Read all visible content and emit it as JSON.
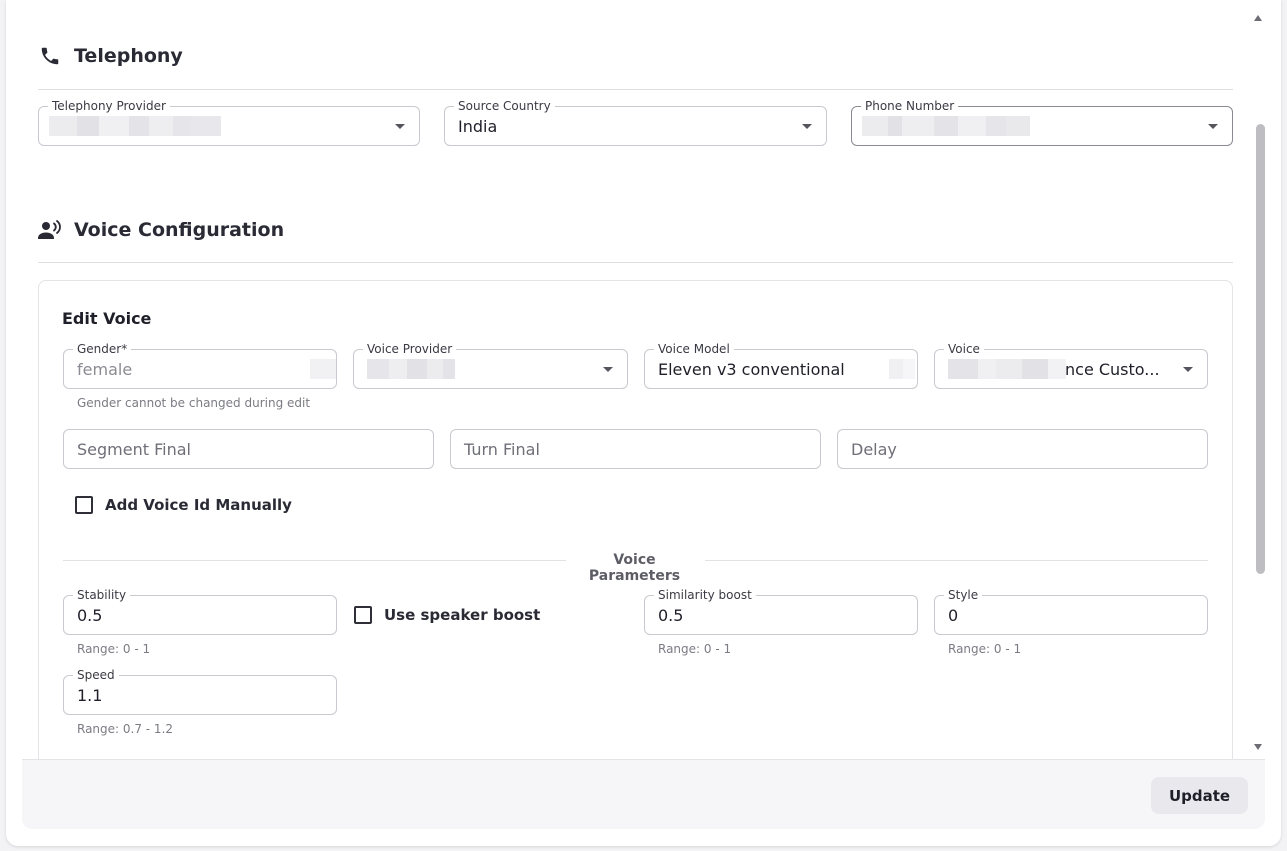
{
  "telephony": {
    "title": "Telephony",
    "provider": {
      "label": "Telephony Provider"
    },
    "country": {
      "label": "Source Country",
      "value": "India"
    },
    "phone": {
      "label": "Phone Number"
    }
  },
  "voice_config": {
    "title": "Voice Configuration",
    "edit_title": "Edit Voice",
    "gender": {
      "label": "Gender",
      "required_mark": "*",
      "value": "female",
      "helper": "Gender cannot be changed during edit"
    },
    "provider": {
      "label": "Voice Provider"
    },
    "model": {
      "label": "Voice Model",
      "value": "Eleven v3 conventional"
    },
    "voice": {
      "label": "Voice",
      "value_visible": "nce Custo..."
    },
    "segment_final": {
      "placeholder": "Segment Final"
    },
    "turn_final": {
      "placeholder": "Turn Final"
    },
    "delay": {
      "placeholder": "Delay"
    },
    "manual_voice_id": {
      "label": "Add Voice Id Manually",
      "checked": false
    },
    "parameters_title": "Voice Parameters",
    "stability": {
      "label": "Stability",
      "value": "0.5",
      "helper": "Range: 0 - 1"
    },
    "speaker_boost": {
      "label": "Use speaker boost",
      "checked": false
    },
    "similarity": {
      "label": "Similarity boost",
      "value": "0.5",
      "helper": "Range: 0 - 1"
    },
    "style": {
      "label": "Style",
      "value": "0",
      "helper": "Range: 0 - 1"
    },
    "speed": {
      "label": "Speed",
      "value": "1.1",
      "helper": "Range: 0.7 - 1.2"
    }
  },
  "footer": {
    "update_label": "Update"
  },
  "colors": {
    "text": "#1f1f29",
    "border": "#c9c9cf",
    "button_bg": "#e9e9ed"
  }
}
